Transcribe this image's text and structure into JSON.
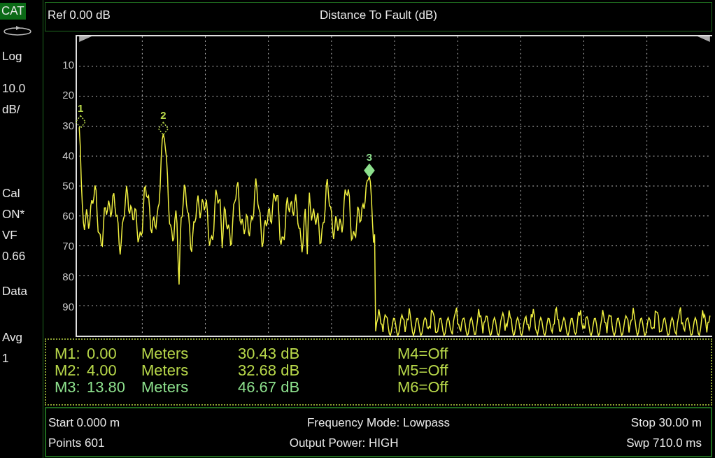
{
  "mode_badge": "CAT",
  "sidebar": [
    {
      "lines": [
        "Log"
      ]
    },
    {
      "lines": [
        "10.0",
        "dB/"
      ]
    },
    {
      "lines": [
        "Cal",
        "ON*",
        "VF",
        "0.66"
      ]
    },
    {
      "lines": [
        "Data"
      ]
    },
    {
      "lines": [
        "Avg",
        "1"
      ]
    }
  ],
  "header": {
    "ref": "Ref 0.00 dB",
    "title": "Distance To Fault (dB)"
  },
  "plot": {
    "y_labels": [
      "10",
      "20",
      "30",
      "40",
      "50",
      "60",
      "70",
      "80",
      "90"
    ],
    "markers": [
      {
        "label": "1",
        "active": false,
        "color": "#b8d84a"
      },
      {
        "label": "2",
        "active": false,
        "color": "#b8d84a"
      },
      {
        "label": "3",
        "active": true,
        "color": "#8de08d"
      }
    ]
  },
  "marker_table": {
    "rows": [
      {
        "name": "M1:",
        "distance": "0.00",
        "unit": "Meters",
        "value": "30.43 dB",
        "color": "#b8d84a"
      },
      {
        "name": "M2:",
        "distance": "4.00",
        "unit": "Meters",
        "value": "32.68 dB",
        "color": "#b8d84a"
      },
      {
        "name": "M3:",
        "distance": "13.80",
        "unit": "Meters",
        "value": "46.67 dB",
        "color": "#8de08d"
      }
    ],
    "off": [
      "M4=Off",
      "M5=Off",
      "M6=Off"
    ]
  },
  "footer": {
    "start": "Start 0.000 m",
    "points": "Points 601",
    "frequency_mode": "Frequency Mode: Lowpass",
    "output_power": "Output Power: HIGH",
    "stop": "Stop 30.00 m",
    "sweep": "Swp 710.0 ms"
  }
}
